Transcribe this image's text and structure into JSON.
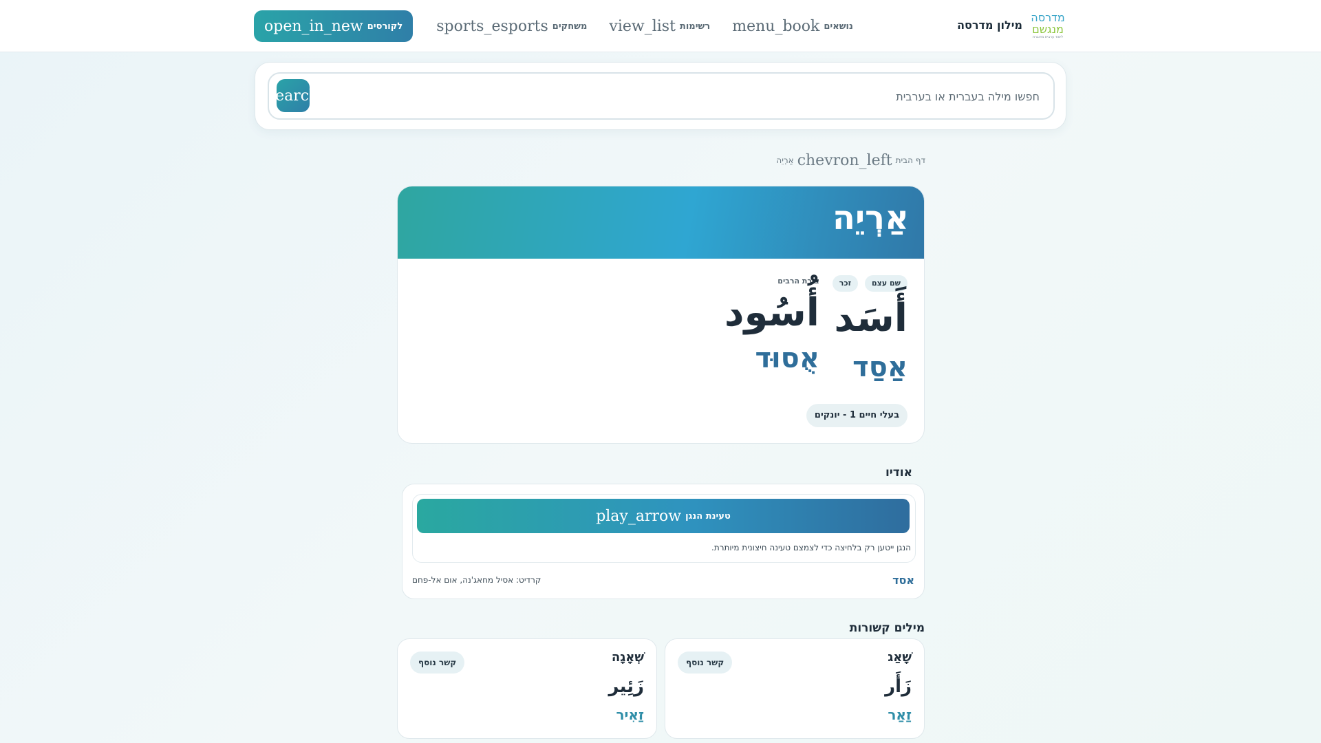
{
  "header": {
    "logo": {
      "line1": "מדרסה",
      "line2": "מנגשם",
      "line3": "לימוד ערבית מדוברת"
    },
    "brand": "מילון מדרסה",
    "nav": [
      {
        "icon": "menu_book",
        "label": "נושאים"
      },
      {
        "icon": "view_list",
        "label": "רשימות"
      },
      {
        "icon": "sports_esports",
        "label": "משחקים"
      },
      {
        "icon": "open_in_new",
        "label": "לקורסים"
      }
    ]
  },
  "search": {
    "placeholder": "חפשו מילה בעברית או בערבית",
    "button_icon": "search"
  },
  "breadcrumb": {
    "home": "דף הבית",
    "separator_icon": "chevron_left",
    "current": "אַרְיֵה"
  },
  "word": {
    "title": "אַרְיֵה",
    "tags": [
      "שם עצם",
      "זכר"
    ],
    "singular_ar": "أَسَد",
    "singular_he": "אַסַד",
    "plural_label": "צורת הרבים",
    "plural_ar": "أُسُود",
    "plural_he": "אֻסוּד",
    "topic": "בעלי חיים 1 - יונקים"
  },
  "audio": {
    "section_title": "אודיו",
    "play_icon": "play_arrow",
    "play_label": "טעינת הנגן",
    "note": "הנגן ייטען רק בלחיצה כדי לצמצם טעינה חיצונית מיותרת.",
    "word": "אסד",
    "credit": "קרדיט: אסיל מחאג'נה, אום אל-פחם"
  },
  "related": {
    "section_title": "מילים קשורות",
    "items": [
      {
        "he_top": "שָׁאַג",
        "ar": "زَأَر",
        "he": "זַאַר",
        "tag": "קשר נוסף"
      },
      {
        "he_top": "שְׁאָגָה",
        "ar": "زَئِير",
        "he": "זַאִיר",
        "tag": "קשר נוסף"
      }
    ]
  },
  "colors": {
    "accent": "#2aa3a8",
    "accent_dark": "#2f7fa8",
    "hebrew_translit": "#2f6e9a"
  }
}
